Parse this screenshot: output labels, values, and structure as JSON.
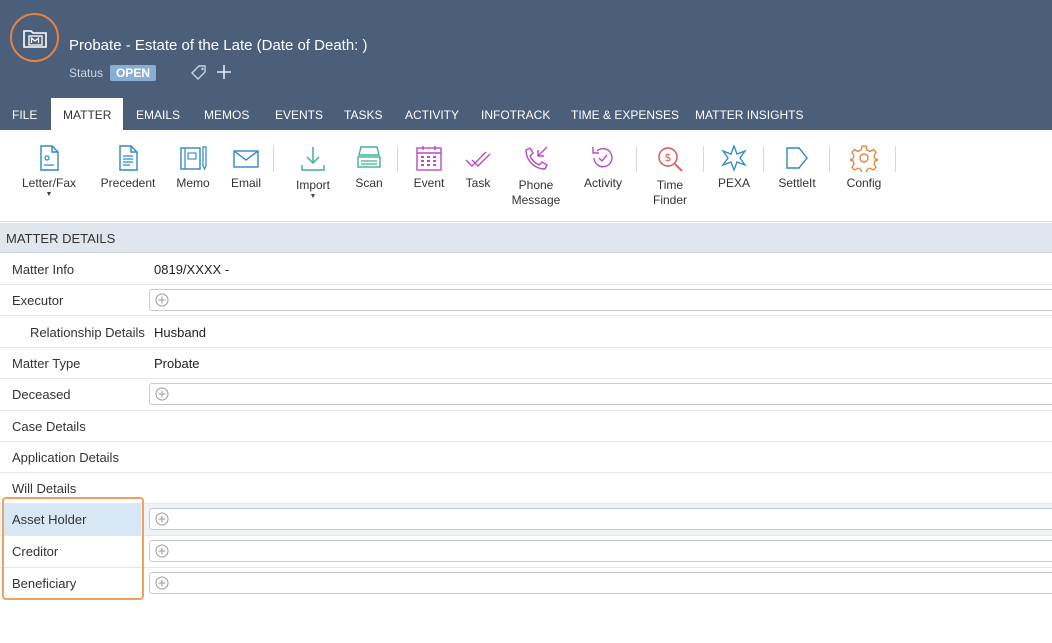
{
  "header": {
    "title": "Probate - Estate of the Late  (Date of Death: )",
    "status_label": "Status",
    "status_value": "OPEN",
    "logo_icon": "matter-folder-icon",
    "accent_color": "#e8823d",
    "bg_color": "#4b5f7b"
  },
  "tabs": [
    {
      "label": "FILE"
    },
    {
      "label": "MATTER"
    },
    {
      "label": "EMAILS"
    },
    {
      "label": "MEMOS"
    },
    {
      "label": "EVENTS"
    },
    {
      "label": "TASKS"
    },
    {
      "label": "ACTIVITY"
    },
    {
      "label": "INFOTRACK"
    },
    {
      "label": "TIME & EXPENSES"
    },
    {
      "label": "MATTER INSIGHTS"
    }
  ],
  "active_tab": "MATTER",
  "ribbon": {
    "letter_fax": "Letter/Fax",
    "precedent": "Precedent",
    "memo": "Memo",
    "email": "Email",
    "import": "Import",
    "scan": "Scan",
    "event": "Event",
    "task": "Task",
    "phone_line1": "Phone",
    "phone_line2": "Message",
    "activity": "Activity",
    "time_line1": "Time",
    "time_line2": "Finder",
    "pexa": "PEXA",
    "settleit": "SettleIt",
    "config": "Config"
  },
  "section": {
    "title": "MATTER DETAILS"
  },
  "rows": {
    "matter_info": {
      "label": "Matter Info",
      "value": "0819/XXXX -"
    },
    "executor": {
      "label": "Executor"
    },
    "relationship": {
      "label": "Relationship Details",
      "value": "Husband"
    },
    "matter_type": {
      "label": "Matter Type",
      "value": "Probate"
    },
    "deceased": {
      "label": "Deceased"
    },
    "case_details": {
      "label": "Case Details"
    },
    "application_details": {
      "label": "Application Details"
    },
    "will_details": {
      "label": "Will Details"
    },
    "asset_holder": {
      "label": "Asset Holder"
    },
    "creditor": {
      "label": "Creditor"
    },
    "beneficiary": {
      "label": "Beneficiary"
    }
  }
}
